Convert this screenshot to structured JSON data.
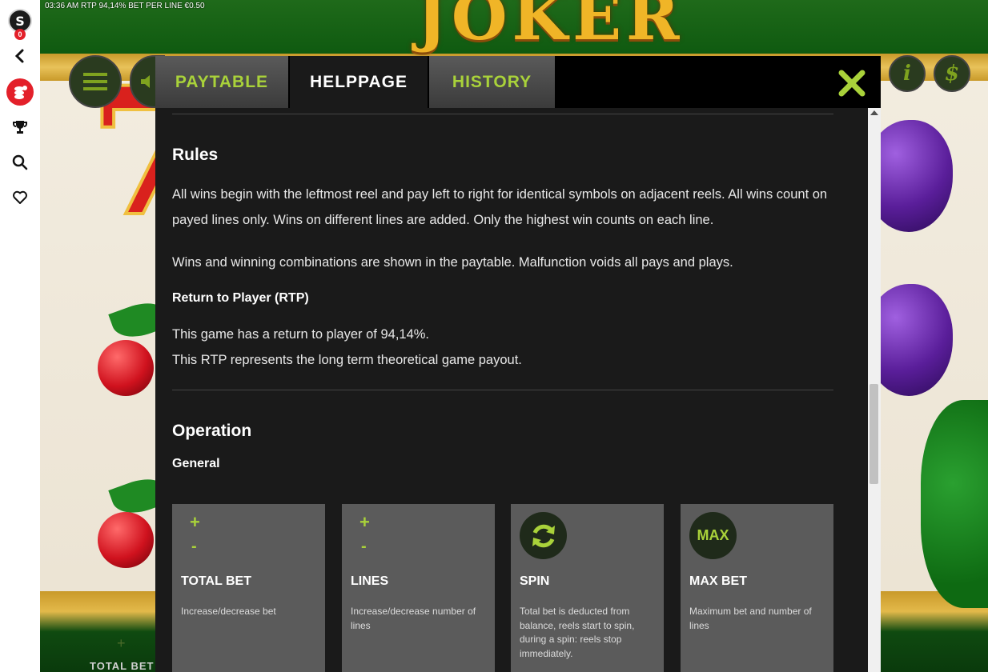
{
  "status_bar": {
    "text": "03:36 AM  RTP 94,14%  BET PER LINE €0.50"
  },
  "site_sidebar": {
    "logo_letter": "S",
    "badge_count": "0",
    "icons": [
      "logo-icon",
      "back-icon",
      "coins-icon",
      "trophy-icon",
      "search-icon",
      "heart-icon"
    ]
  },
  "game": {
    "title": "JOKER",
    "bottom_total_bet_label": "TOTAL BET",
    "bottom_plus": "+"
  },
  "tabs": [
    {
      "label": "PAYTABLE",
      "active": false
    },
    {
      "label": "HELPPAGE",
      "active": true
    },
    {
      "label": "HISTORY",
      "active": false
    }
  ],
  "help": {
    "rules_title": "Rules",
    "rules_p1": "All wins begin with the leftmost reel and pay left to right for identical symbols on adjacent reels. All wins count on payed lines only. Wins on different lines are added. Only the highest win counts on each line.",
    "rules_p2": "Wins and winning combinations are shown in the paytable. Malfunction voids all pays and plays.",
    "rtp_title": "Return to Player (RTP)",
    "rtp_line1": "This game has a return to player of 94,14%.",
    "rtp_line2": "This RTP represents the long term theoretical game payout.",
    "operation_title": "Operation",
    "general_title": "General",
    "cards": [
      {
        "icon": "plus-minus",
        "plus": "+",
        "minus": "-",
        "title": "TOTAL BET",
        "desc": "Increase/decrease bet"
      },
      {
        "icon": "plus-minus",
        "plus": "+",
        "minus": "-",
        "title": "LINES",
        "desc": "Increase/decrease number of lines"
      },
      {
        "icon": "spin-icon",
        "title": "SPIN",
        "desc": "Total bet is deducted from balance, reels start to spin, during a spin: reels stop immediately."
      },
      {
        "icon": "max-icon",
        "icon_text": "MAX",
        "title": "MAX BET",
        "desc": "Maximum bet and number of lines"
      }
    ]
  },
  "colors": {
    "accent_green": "#a9d23a",
    "modal_bg": "#1a1a1a",
    "card_bg": "#5b5b5b",
    "brand_red": "#e3202a"
  }
}
